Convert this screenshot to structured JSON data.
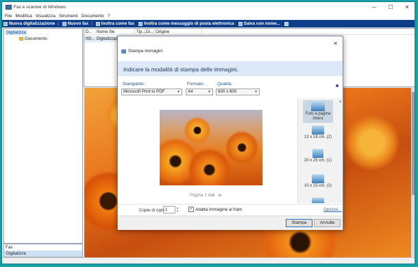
{
  "app": {
    "title": "Fax e scanner di Windows"
  },
  "window_controls": {
    "minimize": "─",
    "maximize": "☐",
    "close": "✕"
  },
  "menu": [
    "File",
    "Modifica",
    "Visualizza",
    "Strumenti",
    "Documento",
    "?"
  ],
  "toolbar": {
    "new_scan": "Nuova digitalizzazione",
    "new_fax": "Nuovo fax",
    "forward_fax": "Inoltra come fax",
    "forward_email": "Inoltra come messaggio di posta elettronica",
    "save_as": "Salva con nome..."
  },
  "tree": {
    "root": "Digitalizza",
    "child": "Documents"
  },
  "file_list": {
    "columns": [
      "D...",
      "Nome file",
      "Tip...",
      "Di...",
      "Origine"
    ],
    "rows": [
      {
        "date": "05/...",
        "name": "Digitalizzazio..."
      }
    ]
  },
  "nav": {
    "fax": "Fax",
    "scan": "Digitalizza"
  },
  "dialog": {
    "title": "Stampa immagini",
    "close": "✕",
    "heading": "Indicare la modalità di stampa delle immagini.",
    "printer_label": "Stampante:",
    "printer_value": "Microsoft Print to PDF",
    "format_label": "Formato:",
    "format_value": "A4",
    "quality_label": "Qualità:",
    "quality_value": "600 x 600",
    "page_info": "Pagina 1 di 1",
    "layouts": [
      "Foto a pagina intera",
      "13 x 18 cm. (2)",
      "20 x 25 cm. (1)",
      "10 x 15 cm. (2)"
    ],
    "copies_label": "Copie di ogni",
    "copies_value": "1",
    "fit_label": "Adatta immagine al fram",
    "options_link": "Opzioni...",
    "print_button": "Stampa",
    "cancel_button": "Annulla"
  }
}
